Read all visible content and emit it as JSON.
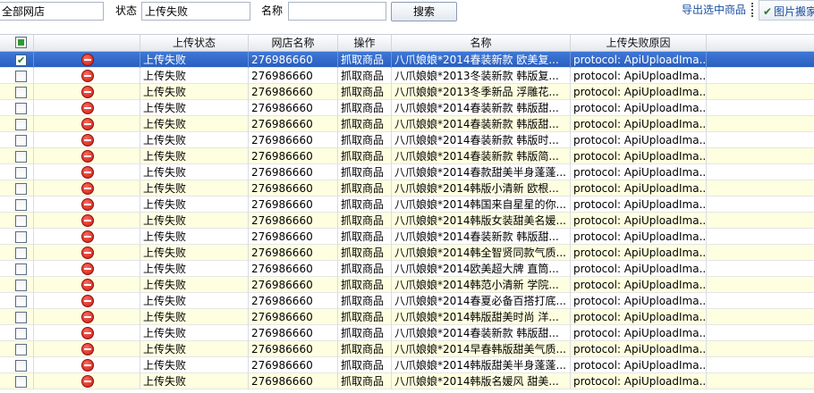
{
  "toolbar": {
    "shop_select_value": "全部网店",
    "status_label": "状态",
    "status_value": "上传失败",
    "name_label": "名称",
    "name_value": "",
    "search_button": "搜索",
    "export_link": "导出选中商品",
    "image_button": "图片搬家",
    "image_icon": "check-pen-icon"
  },
  "table": {
    "headers": {
      "select_all": "",
      "upload_status": "上传状态",
      "shop_name": "网店名称",
      "operation": "操作",
      "name": "名称",
      "fail_reason": "上传失败原因"
    },
    "status_icon": "stop-icon",
    "rows": [
      {
        "checked": true,
        "status": "上传失败",
        "shop": "276986660",
        "op": "抓取商品",
        "name": "八爪娘娘*2014春装新款 欧美复...",
        "reason": "protocol: ApiUploadIma..."
      },
      {
        "checked": false,
        "status": "上传失败",
        "shop": "276986660",
        "op": "抓取商品",
        "name": "八爪娘娘*2013冬装新款 韩版复...",
        "reason": "protocol: ApiUploadIma..."
      },
      {
        "checked": false,
        "status": "上传失败",
        "shop": "276986660",
        "op": "抓取商品",
        "name": "八爪娘娘*2013冬季新品 浮雕花...",
        "reason": "protocol: ApiUploadIma..."
      },
      {
        "checked": false,
        "status": "上传失败",
        "shop": "276986660",
        "op": "抓取商品",
        "name": "八爪娘娘*2014春装新款 韩版甜...",
        "reason": "protocol: ApiUploadIma..."
      },
      {
        "checked": false,
        "status": "上传失败",
        "shop": "276986660",
        "op": "抓取商品",
        "name": "八爪娘娘*2014春装新款 韩版甜...",
        "reason": "protocol: ApiUploadIma..."
      },
      {
        "checked": false,
        "status": "上传失败",
        "shop": "276986660",
        "op": "抓取商品",
        "name": "八爪娘娘*2014春装新款 韩版时...",
        "reason": "protocol: ApiUploadIma..."
      },
      {
        "checked": false,
        "status": "上传失败",
        "shop": "276986660",
        "op": "抓取商品",
        "name": "八爪娘娘*2014春装新款 韩版简...",
        "reason": "protocol: ApiUploadIma..."
      },
      {
        "checked": false,
        "status": "上传失败",
        "shop": "276986660",
        "op": "抓取商品",
        "name": "八爪娘娘*2014春款甜美半身蓬蓬...",
        "reason": "protocol: ApiUploadIma..."
      },
      {
        "checked": false,
        "status": "上传失败",
        "shop": "276986660",
        "op": "抓取商品",
        "name": "八爪娘娘*2014韩版小清新 欧根...",
        "reason": "protocol: ApiUploadIma..."
      },
      {
        "checked": false,
        "status": "上传失败",
        "shop": "276986660",
        "op": "抓取商品",
        "name": "八爪娘娘*2014韩国来自星星的你...",
        "reason": "protocol: ApiUploadIma..."
      },
      {
        "checked": false,
        "status": "上传失败",
        "shop": "276986660",
        "op": "抓取商品",
        "name": "八爪娘娘*2014韩版女装甜美名媛...",
        "reason": "protocol: ApiUploadIma..."
      },
      {
        "checked": false,
        "status": "上传失败",
        "shop": "276986660",
        "op": "抓取商品",
        "name": "八爪娘娘*2014春装新款 韩版甜...",
        "reason": "protocol: ApiUploadIma..."
      },
      {
        "checked": false,
        "status": "上传失败",
        "shop": "276986660",
        "op": "抓取商品",
        "name": "八爪娘娘*2014韩全智贤同款气质...",
        "reason": "protocol: ApiUploadIma..."
      },
      {
        "checked": false,
        "status": "上传失败",
        "shop": "276986660",
        "op": "抓取商品",
        "name": "八爪娘娘*2014欧美超大牌 直筒...",
        "reason": "protocol: ApiUploadIma..."
      },
      {
        "checked": false,
        "status": "上传失败",
        "shop": "276986660",
        "op": "抓取商品",
        "name": "八爪娘娘*2014韩范小清新 学院...",
        "reason": "protocol: ApiUploadIma..."
      },
      {
        "checked": false,
        "status": "上传失败",
        "shop": "276986660",
        "op": "抓取商品",
        "name": "八爪娘娘*2014春夏必备百搭打底...",
        "reason": "protocol: ApiUploadIma..."
      },
      {
        "checked": false,
        "status": "上传失败",
        "shop": "276986660",
        "op": "抓取商品",
        "name": "八爪娘娘*2014韩版甜美时尚 洋...",
        "reason": "protocol: ApiUploadIma..."
      },
      {
        "checked": false,
        "status": "上传失败",
        "shop": "276986660",
        "op": "抓取商品",
        "name": "八爪娘娘*2014春装新款 韩版甜...",
        "reason": "protocol: ApiUploadIma..."
      },
      {
        "checked": false,
        "status": "上传失败",
        "shop": "276986660",
        "op": "抓取商品",
        "name": "八爪娘娘*2014早春韩版甜美气质...",
        "reason": "protocol: ApiUploadIma..."
      },
      {
        "checked": false,
        "status": "上传失败",
        "shop": "276986660",
        "op": "抓取商品",
        "name": "八爪娘娘*2014韩版甜美半身蓬蓬...",
        "reason": "protocol: ApiUploadIma..."
      },
      {
        "checked": false,
        "status": "上传失败",
        "shop": "276986660",
        "op": "抓取商品",
        "name": "八爪娘娘*2014韩版名媛风 甜美...",
        "reason": "protocol: ApiUploadIma..."
      }
    ]
  }
}
